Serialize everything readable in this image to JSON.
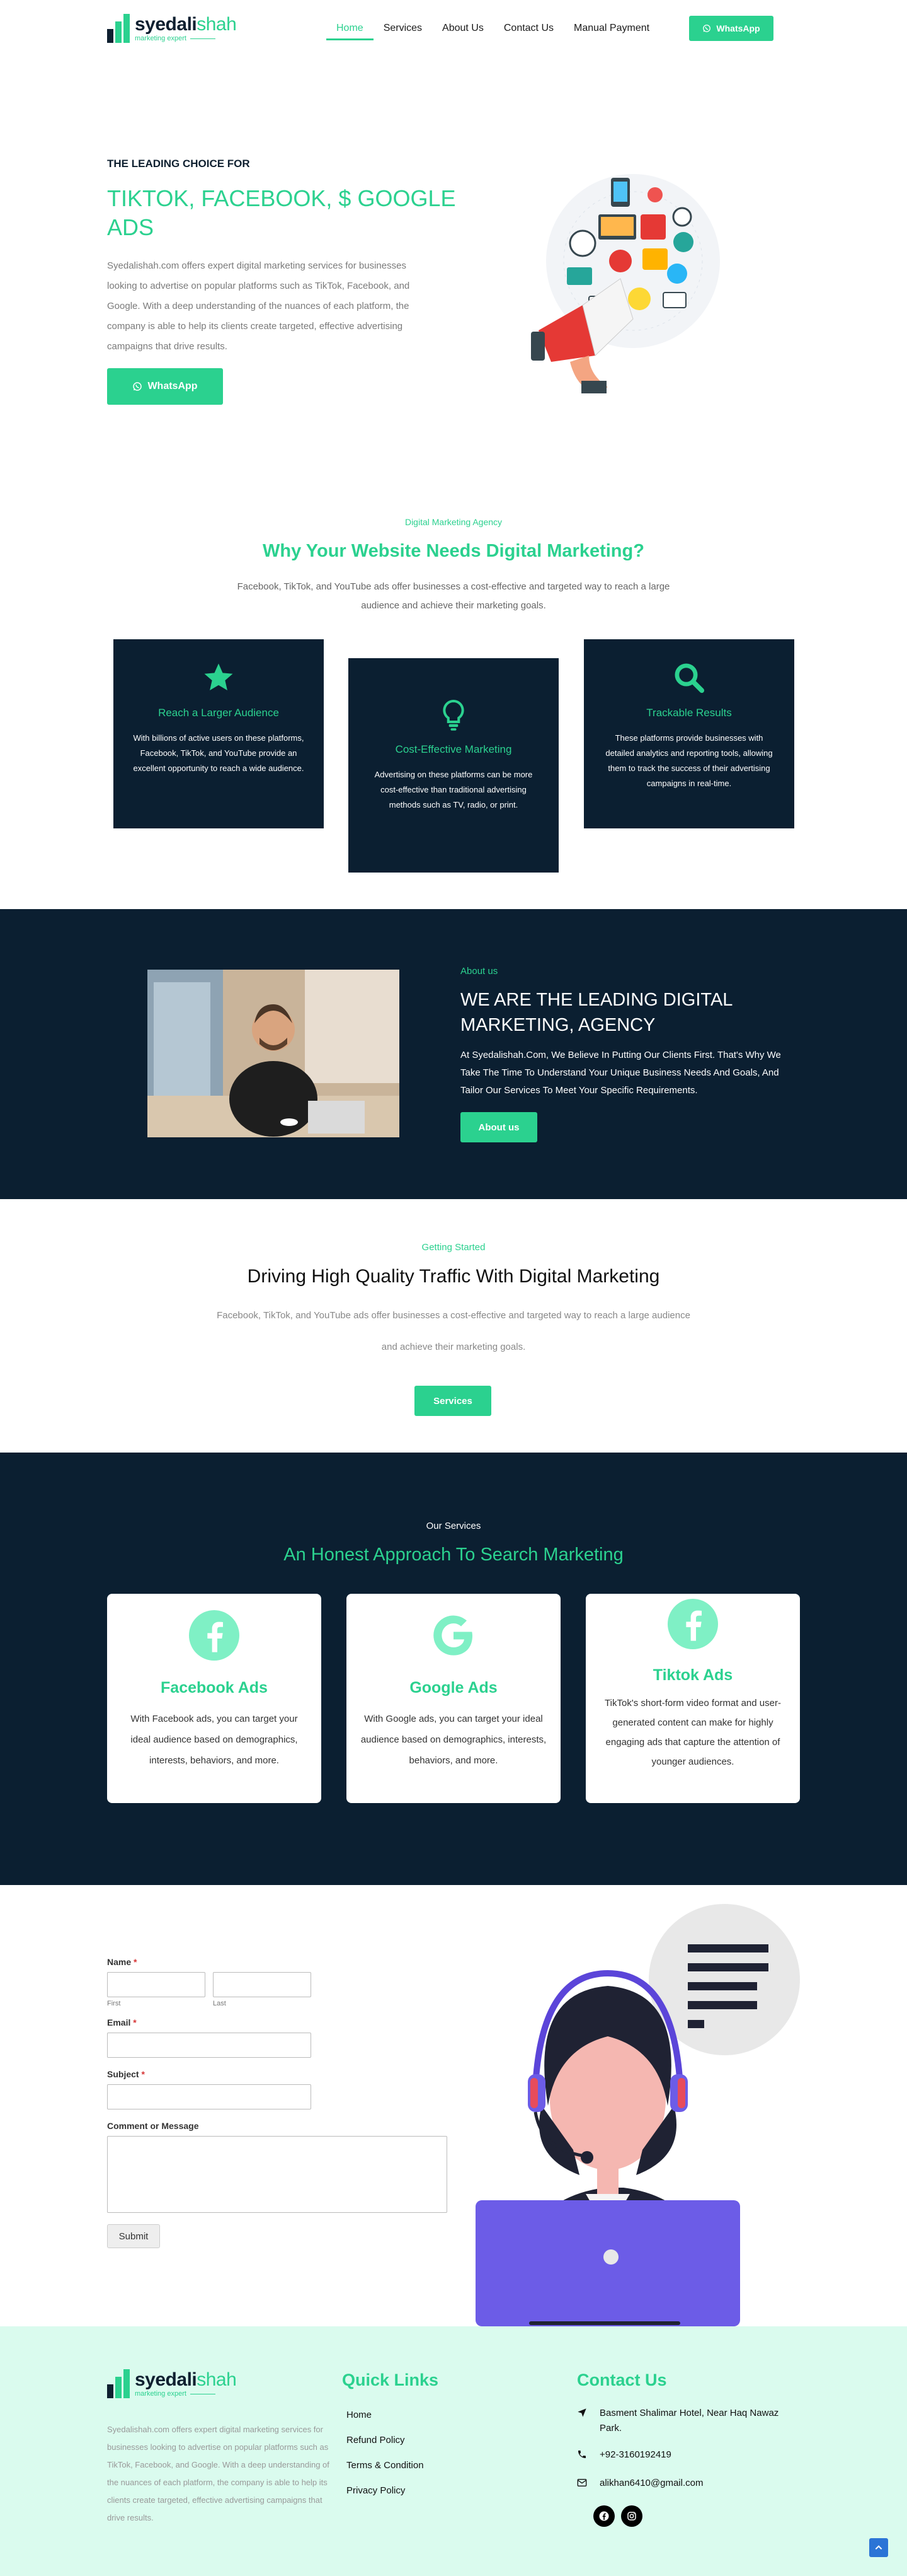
{
  "header": {
    "logo": {
      "name_part1": "syedali",
      "name_part2": "shah",
      "tagline": "marketing expert"
    },
    "nav": [
      "Home",
      "Services",
      "About Us",
      "Contact Us",
      "Manual Payment"
    ],
    "whatsapp_label": "WhatsApp"
  },
  "hero": {
    "kicker": "THE LEADING CHOICE FOR",
    "title": "TIKTOK, FACEBOOK, $ GOOGLE ADS",
    "description": "Syedalishah.com offers expert digital marketing services for businesses looking to advertise on popular platforms such as TikTok, Facebook, and Google. With a deep understanding of the nuances of each platform, the company is able to help its clients create targeted, effective advertising campaigns that drive results.",
    "whatsapp_label": "WhatsApp"
  },
  "why": {
    "kicker": "Digital Marketing Agency",
    "title": "Why Your Website Needs Digital Marketing?",
    "description": "Facebook, TikTok, and YouTube ads offer businesses a cost-effective and targeted way to reach a large audience and achieve their marketing goals.",
    "cards": [
      {
        "icon": "star-icon",
        "title": "Reach a Larger Audience",
        "desc": "With billions of active users on these platforms, Facebook, TikTok, and YouTube provide an excellent opportunity to reach a wide audience."
      },
      {
        "icon": "lightbulb-icon",
        "title": "Cost-Effective Marketing",
        "desc": "Advertising on these platforms can be more cost-effective than traditional advertising methods such as TV, radio, or print."
      },
      {
        "icon": "search-icon",
        "title": "Trackable Results",
        "desc": "These platforms provide businesses with detailed analytics and reporting tools, allowing them to track the success of their advertising campaigns in real-time."
      }
    ]
  },
  "about": {
    "kicker": "About us",
    "title": "WE ARE THE LEADING DIGITAL MARKETING, AGENCY",
    "description": "At Syedalishah.Com, We Believe In Putting Our Clients First. That's Why We Take The Time To Understand Your Unique Business Needs And Goals, And Tailor Our Services To Meet Your Specific Requirements.",
    "button": "About us"
  },
  "drive": {
    "kicker": "Getting Started",
    "title": "Driving High Quality Traffic With Digital Marketing",
    "line1": "Facebook, TikTok, and YouTube ads offer businesses a cost-effective and targeted way to reach a large audience",
    "line2": "and achieve their marketing goals.",
    "button": "Services"
  },
  "services": {
    "kicker": "Our Services",
    "title": "An Honest Approach To Search Marketing",
    "items": [
      {
        "icon": "facebook-icon",
        "title": "Facebook Ads",
        "desc": "With Facebook ads, you can target your ideal audience based on demographics, interests, behaviors, and more."
      },
      {
        "icon": "google-icon",
        "title": "Google Ads",
        "desc": "With Google ads, you can target your ideal audience based on demographics, interests, behaviors, and more."
      },
      {
        "icon": "facebook-icon",
        "title": "Tiktok Ads",
        "desc": "TikTok's short-form video format and user-generated content can make for highly engaging ads that capture the attention of younger audiences."
      }
    ]
  },
  "form": {
    "name_label": "Name",
    "required_mark": "*",
    "first_sublabel": "First",
    "last_sublabel": "Last",
    "email_label": "Email",
    "subject_label": "Subject",
    "message_label": "Comment or Message",
    "submit_label": "Submit"
  },
  "footer": {
    "description": "Syedalishah.com offers expert digital marketing services for businesses looking to advertise on popular platforms such as TikTok, Facebook, and Google. With a deep understanding of the nuances of each platform, the company is able to help its clients create targeted, effective advertising campaigns that drive results.",
    "quick_links_title": "Quick Links",
    "quick_links": [
      "Home",
      "Refund Policy",
      "Terms & Condition",
      "Privacy Policy"
    ],
    "contact_title": "Contact Us",
    "address": "Basment Shalimar Hotel, Near Haq Nawaz Park.",
    "phone": "+92-3160192419",
    "email": "alikhan6410@gmail.com"
  },
  "colors": {
    "accent": "#2bd18f",
    "dark": "#0b1f31",
    "footer_bg": "#dafbee"
  }
}
